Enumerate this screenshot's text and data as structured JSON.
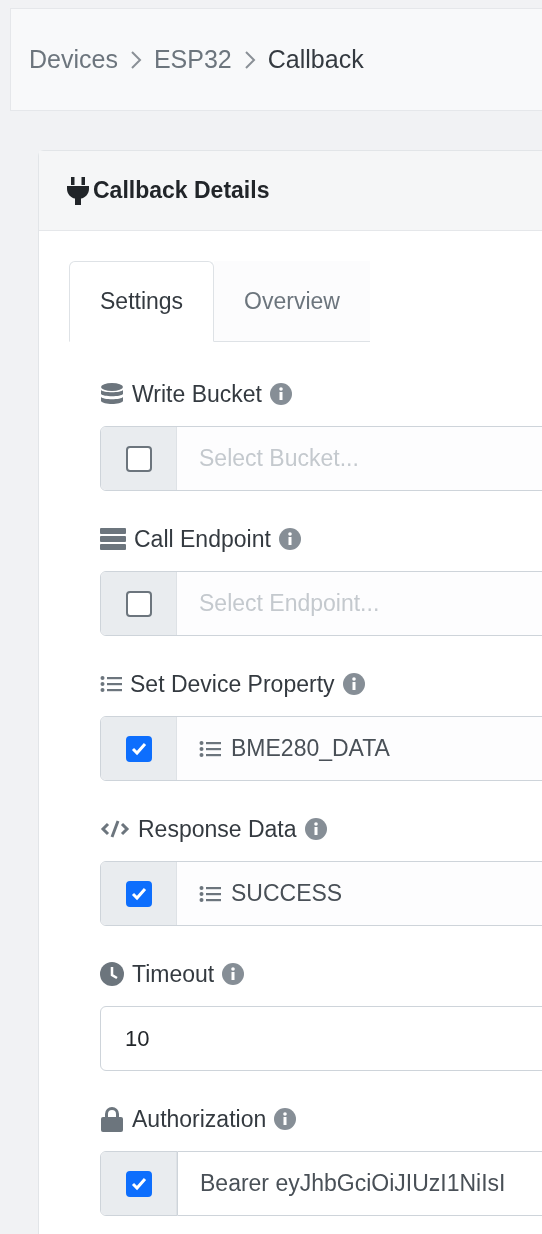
{
  "breadcrumb": [
    {
      "label": "Devices",
      "current": false
    },
    {
      "label": "ESP32",
      "current": false
    },
    {
      "label": "Callback",
      "current": true
    }
  ],
  "card": {
    "title": "Callback Details"
  },
  "tabs": [
    {
      "label": "Settings",
      "selected": true
    },
    {
      "label": "Overview",
      "selected": false
    }
  ],
  "fields": [
    {
      "label": "Write Bucket",
      "kind": "select",
      "checked": false,
      "placeholder": "Select Bucket..."
    },
    {
      "label": "Call Endpoint",
      "kind": "select",
      "checked": false,
      "placeholder": "Select Endpoint..."
    },
    {
      "label": "Set Device Property",
      "kind": "select",
      "checked": true,
      "value": "BME280_DATA"
    },
    {
      "label": "Response Data",
      "kind": "select",
      "checked": true,
      "value": "SUCCESS"
    },
    {
      "label": "Timeout",
      "kind": "number",
      "value": "10"
    },
    {
      "label": "Authorization",
      "kind": "text",
      "checked": true,
      "value": "Bearer eyJhbGciOiJIUzI1NiIsI"
    }
  ]
}
